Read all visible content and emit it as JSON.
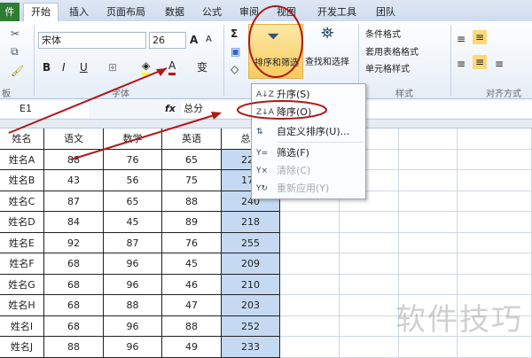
{
  "tabs": {
    "file": "件",
    "items": [
      "开始",
      "插入",
      "页面布局",
      "数据",
      "公式",
      "审阅",
      "视图",
      "开发工具",
      "团队"
    ]
  },
  "ribbon": {
    "font_name": "宋体",
    "font_size": "26",
    "groups": {
      "clipboard": "板",
      "font": "字体",
      "styles": "样式",
      "alignment": "对齐方式"
    },
    "sort_filter": "排序和筛选",
    "find_select": "查找和选择",
    "styles": [
      "条件格式",
      "套用表格格式",
      "单元格样式"
    ]
  },
  "formula_bar": {
    "cell_ref": "E1",
    "fx": "fx",
    "value": "总分"
  },
  "sort_menu": [
    {
      "label": "升序(S)",
      "icon": "A↓Z",
      "enabled": true
    },
    {
      "label": "降序(O)",
      "icon": "Z↓A",
      "enabled": true
    },
    {
      "label": "自定义排序(U)...",
      "icon": "⇅",
      "enabled": true
    },
    {
      "label": "筛选(F)",
      "icon": "Y=",
      "enabled": true
    },
    {
      "label": "清除(C)",
      "icon": "Y×",
      "enabled": false
    },
    {
      "label": "重新应用(Y)",
      "icon": "Y↻",
      "enabled": false
    }
  ],
  "table": {
    "headers": [
      "姓名",
      "语文",
      "数学",
      "英语",
      "总分"
    ],
    "rows": [
      [
        "姓名A",
        "88",
        "76",
        "65",
        "229"
      ],
      [
        "姓名B",
        "43",
        "56",
        "75",
        "174"
      ],
      [
        "姓名C",
        "87",
        "65",
        "88",
        "240"
      ],
      [
        "姓名D",
        "84",
        "45",
        "89",
        "218"
      ],
      [
        "姓名E",
        "92",
        "87",
        "76",
        "255"
      ],
      [
        "姓名F",
        "68",
        "96",
        "45",
        "209"
      ],
      [
        "姓名G",
        "68",
        "96",
        "46",
        "210"
      ],
      [
        "姓名H",
        "68",
        "88",
        "47",
        "203"
      ],
      [
        "姓名I",
        "68",
        "96",
        "88",
        "252"
      ],
      [
        "姓名J",
        "88",
        "96",
        "49",
        "233"
      ]
    ]
  },
  "watermark": "软件技巧"
}
